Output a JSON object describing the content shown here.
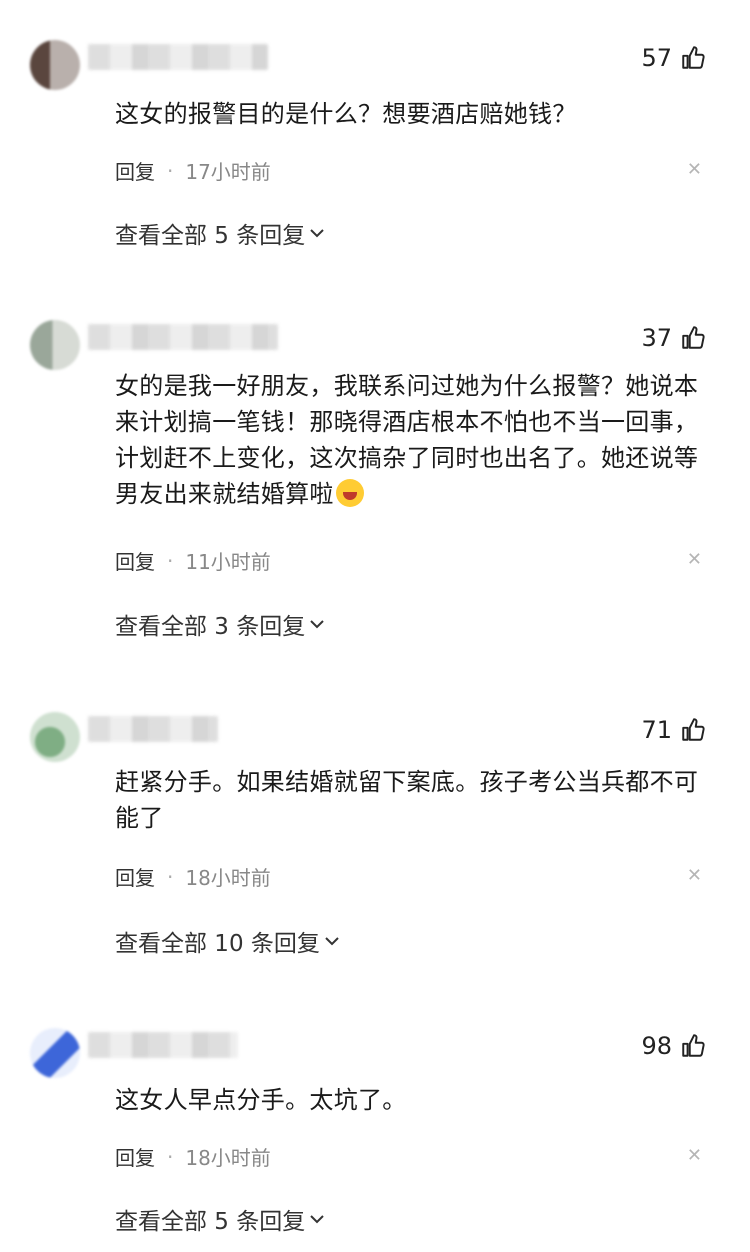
{
  "comments": [
    {
      "likes": "57",
      "text": "这女的报警目的是什么？想要酒店赔她钱？",
      "reply_label": "回复",
      "time": "17小时前",
      "view_replies": "查看全部 5 条回复"
    },
    {
      "likes": "37",
      "text": "女的是我一好朋友，我联系问过她为什么报警？她说本来计划搞一笔钱！那晓得酒店根本不怕也不当一回事，计划赶不上变化，这次搞杂了同时也出名了。她还说等男友出来就结婚算啦",
      "reply_label": "回复",
      "time": "11小时前",
      "view_replies": "查看全部 3 条回复"
    },
    {
      "likes": "71",
      "text": "赶紧分手。如果结婚就留下案底。孩子考公当兵都不可能了",
      "reply_label": "回复",
      "time": "18小时前",
      "view_replies": "查看全部 10 条回复"
    },
    {
      "likes": "98",
      "text": "这女人早点分手。太坑了。",
      "reply_label": "回复",
      "time": "18小时前",
      "view_replies": "查看全部 5 条回复"
    }
  ],
  "icons": {
    "like": "thumbs-up-icon",
    "close": "close-icon",
    "chevron": "chevron-down-icon",
    "emoji": "laughing-emoji-icon"
  }
}
